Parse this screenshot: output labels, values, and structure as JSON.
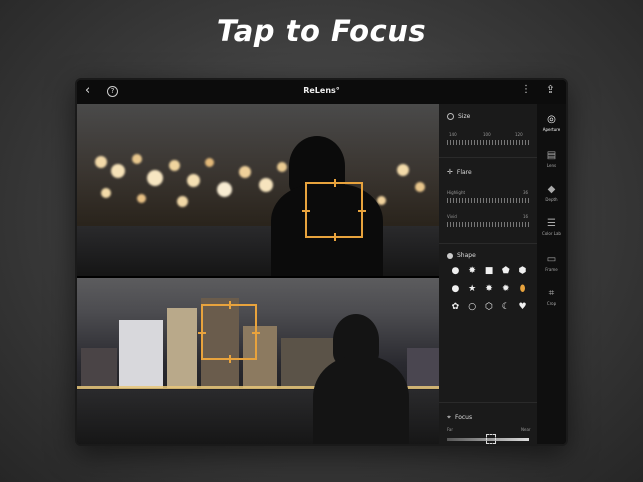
{
  "headline": "Tap to Focus",
  "app": {
    "brand": "ReLens",
    "brand_mark": "°",
    "back_glyph": "‹",
    "help_glyph": "?",
    "more_glyph": "⋮",
    "share_glyph": "⇪"
  },
  "panel": {
    "size": {
      "title": "Size",
      "ticks": [
        "140",
        "100",
        "120"
      ]
    },
    "flare": {
      "title": "Flare",
      "highlight_label": "Highlight",
      "highlight_value": "36",
      "vivid_label": "Vivid",
      "vivid_value": "16"
    },
    "shape": {
      "title": "Shape",
      "glyphs": [
        "●",
        "✸",
        "■",
        "⬟",
        "⬢",
        "●",
        "★",
        "✸",
        "✹",
        "⬮",
        "✿",
        "○",
        "⬡",
        "☾",
        "♥"
      ],
      "selected_index": 9
    },
    "focus": {
      "title": "Focus",
      "left_label": "Far",
      "right_label": "Near"
    }
  },
  "toolbar": {
    "items": [
      {
        "glyph": "◎",
        "label": "Aperture",
        "active": true
      },
      {
        "glyph": "▤",
        "label": "Lens",
        "active": false
      },
      {
        "glyph": "◆",
        "label": "Depth",
        "active": false
      },
      {
        "glyph": "☰",
        "label": "Color Lab",
        "active": false
      },
      {
        "glyph": "▭",
        "label": "Frame",
        "active": false
      },
      {
        "glyph": "⌗",
        "label": "Crop",
        "active": false
      }
    ]
  },
  "colors": {
    "focus_accent": "#e8a33d",
    "panel_bg": "#1a1a1a",
    "toolbar_bg": "#0f0f0f"
  }
}
